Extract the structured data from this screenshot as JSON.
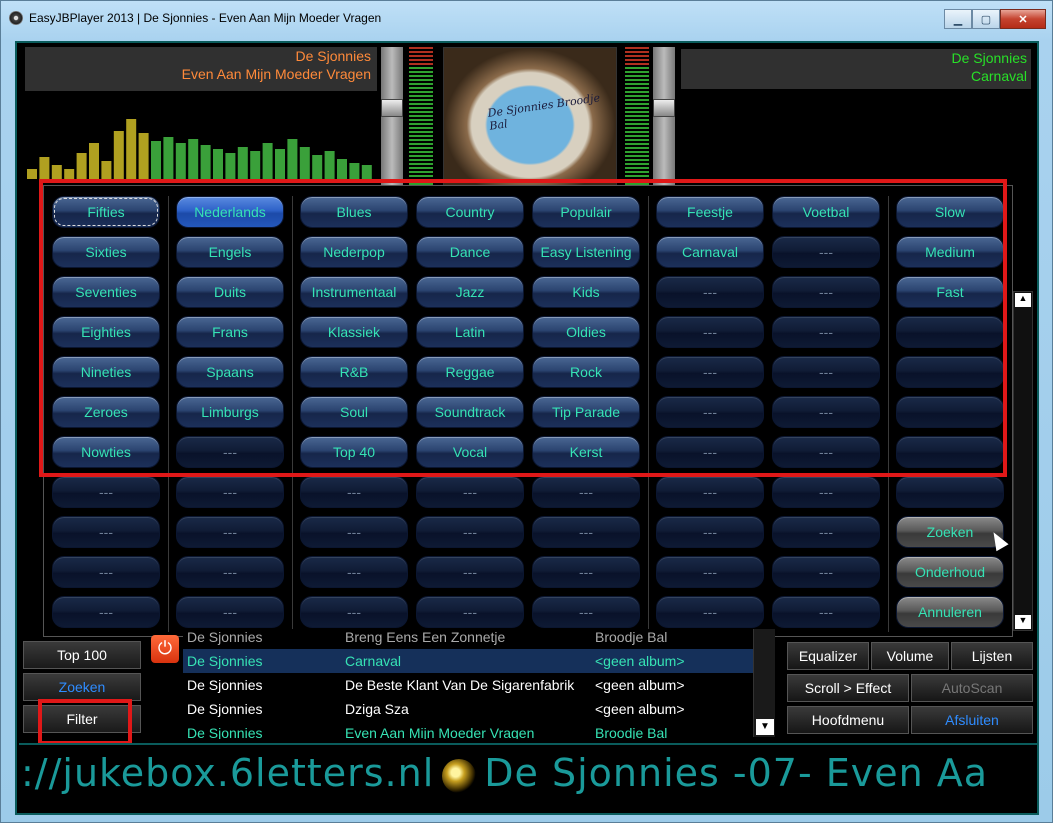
{
  "window": {
    "title": "EasyJBPlayer 2013 | De Sjonnies - Even Aan Mijn Moeder Vragen",
    "minimize_glyph": "▁",
    "maximize_glyph": "▢",
    "close_glyph": "✕"
  },
  "deck_a": {
    "artist": "De Sjonnies",
    "title": "Even Aan Mijn Moeder Vragen"
  },
  "deck_b": {
    "artist": "De Sjonnies",
    "title": "Carnaval"
  },
  "cover": {
    "text": "De Sjonnies  Broodje Bal"
  },
  "genres": {
    "col1": [
      "Fifties",
      "Sixties",
      "Seventies",
      "Eighties",
      "Nineties",
      "Zeroes",
      "Nowties",
      "---",
      "---",
      "---",
      "---"
    ],
    "col2": [
      "Nederlands",
      "Engels",
      "Duits",
      "Frans",
      "Spaans",
      "Limburgs",
      "---",
      "---",
      "---",
      "---",
      "---"
    ],
    "col3": [
      "Blues",
      "Nederpop",
      "Instrumentaal",
      "Klassiek",
      "R&B",
      "Soul",
      "Top 40",
      "---",
      "---",
      "---",
      "---"
    ],
    "col4": [
      "Country",
      "Dance",
      "Jazz",
      "Latin",
      "Reggae",
      "Soundtrack",
      "Vocal",
      "---",
      "---",
      "---",
      "---"
    ],
    "col5": [
      "Populair",
      "Easy Listening",
      "Kids",
      "Oldies",
      "Rock",
      "Tip Parade",
      "Kerst",
      "---",
      "---",
      "---",
      "---"
    ],
    "col6": [
      "Feestje",
      "Carnaval",
      "---",
      "---",
      "---",
      "---",
      "---",
      "---",
      "---",
      "---",
      "---"
    ],
    "col7": [
      "Voetbal",
      "---",
      "---",
      "---",
      "---",
      "---",
      "---",
      "---",
      "---",
      "---",
      "---"
    ],
    "col8": [
      "Slow",
      "Medium",
      "Fast",
      "",
      "",
      "",
      "",
      ""
    ]
  },
  "actions": {
    "search": "Zoeken",
    "maintenance": "Onderhoud",
    "cancel": "Annuleren"
  },
  "left_buttons": {
    "top100": "Top 100",
    "search": "Zoeken",
    "filter": "Filter"
  },
  "playlist": {
    "rows": [
      {
        "artist": "De Sjonnies",
        "title": "Breng Eens Een Zonnetje",
        "album": "Broodje Bal"
      },
      {
        "artist": "De Sjonnies",
        "title": "Carnaval",
        "album": "<geen album>"
      },
      {
        "artist": "De Sjonnies",
        "title": "De Beste Klant Van De Sigarenfabrik",
        "album": "<geen album>"
      },
      {
        "artist": "De Sjonnies",
        "title": "Dziga Sza",
        "album": "<geen album>"
      },
      {
        "artist": "De Sjonnies",
        "title": "Even Aan Mijn Moeder Vragen",
        "album": "Broodje Bal"
      }
    ]
  },
  "right_buttons": {
    "equalizer": "Equalizer",
    "volume": "Volume",
    "lists": "Lijsten",
    "scroll_effect": "Scroll > Effect",
    "autoscan": "AutoScan",
    "main_menu": "Hoofdmenu",
    "quit": "Afsluiten"
  },
  "ticker": {
    "part1": "://jukebox.6letters.nl",
    "part2": "De Sjonnies -07- Even Aa"
  },
  "colors": {
    "accent_teal": "#36e3b5",
    "highlight_red": "#e01818",
    "deck_a_orange": "#ff8a3a",
    "deck_b_green": "#28e028"
  }
}
